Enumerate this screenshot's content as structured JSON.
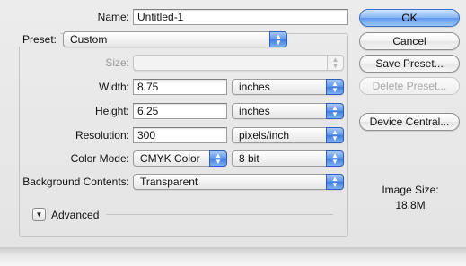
{
  "name": {
    "label": "Name:",
    "value": "Untitled-1"
  },
  "preset": {
    "label": "Preset:",
    "value": "Custom"
  },
  "size": {
    "label": "Size:",
    "value": ""
  },
  "width": {
    "label": "Width:",
    "value": "8.75",
    "unit": "inches"
  },
  "height": {
    "label": "Height:",
    "value": "6.25",
    "unit": "inches"
  },
  "resolution": {
    "label": "Resolution:",
    "value": "300",
    "unit": "pixels/inch"
  },
  "color_mode": {
    "label": "Color Mode:",
    "mode": "CMYK Color",
    "depth": "8 bit"
  },
  "background": {
    "label": "Background Contents:",
    "value": "Transparent"
  },
  "advanced": {
    "label": "Advanced"
  },
  "buttons": {
    "ok": "OK",
    "cancel": "Cancel",
    "save_preset": "Save Preset...",
    "delete_preset": "Delete Preset...",
    "device_central": "Device Central..."
  },
  "image_size": {
    "label": "Image Size:",
    "value": "18.8M"
  },
  "colors": {
    "accent": "#5b93e8",
    "window": "#e8e8e8"
  },
  "icons": {
    "popup_arrows": "up-down-arrows-icon",
    "disclosure": "disclosure-triangle-icon"
  }
}
